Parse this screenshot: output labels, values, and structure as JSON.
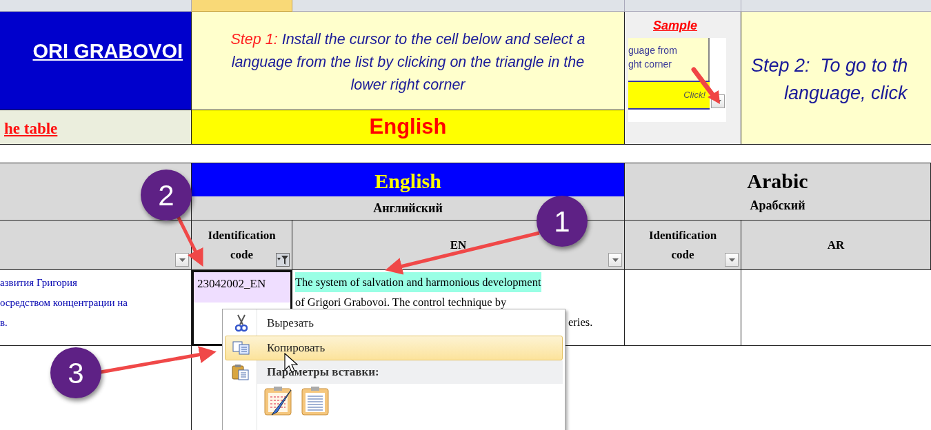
{
  "title_cell": {
    "text": "ORI GRABOVOI"
  },
  "table_link": {
    "text": "he table"
  },
  "step1": {
    "label": "Step 1:",
    "lines": [
      "Install the cursor to the cell below and select a",
      "language from the list by clicking on the triangle in the",
      "lower right corner"
    ]
  },
  "language_select": {
    "value": "English"
  },
  "sample": {
    "title": "Sample",
    "lines": [
      "guage from",
      "ght corner"
    ],
    "button": "Click!"
  },
  "step2": {
    "lines": [
      "Step 2:  To go to th",
      "language, click"
    ]
  },
  "languages": [
    {
      "name": "English",
      "native": "Английский",
      "selected": true
    },
    {
      "name": "Arabic",
      "native": "Арабский",
      "selected": false
    }
  ],
  "columns": [
    {
      "kind": "blank",
      "dropdown": true,
      "filtered": false
    },
    {
      "kind": "label",
      "label": "Identification code",
      "dropdown": true,
      "filtered": true
    },
    {
      "kind": "label",
      "label": "EN",
      "dropdown": true,
      "filtered": false
    },
    {
      "kind": "label",
      "label": "Identification code",
      "dropdown": true,
      "filtered": false
    },
    {
      "kind": "label",
      "label": "AR",
      "dropdown": false
    }
  ],
  "row": {
    "description_ru": [
      "азвития Григория",
      "осредством концентрации на",
      "в."
    ],
    "code": "23042002_EN",
    "code_selected": true,
    "text_en": [
      {
        "text": "The system of salvation and harmonious development",
        "highlight": true
      },
      {
        "text": "of Grigori Grabovoi. The control technique by",
        "highlight": false
      },
      {
        "text": "eries.",
        "highlight": false
      }
    ]
  },
  "context_menu": {
    "items": [
      {
        "kind": "command",
        "label": "Вырезать",
        "selected": false
      },
      {
        "kind": "command",
        "label": "Копировать",
        "selected": true
      },
      {
        "kind": "header",
        "label": "Параметры вставки:"
      },
      {
        "kind": "paste-options"
      }
    ]
  },
  "markers": [
    {
      "label": "1"
    },
    {
      "label": "2"
    },
    {
      "label": "3"
    }
  ]
}
